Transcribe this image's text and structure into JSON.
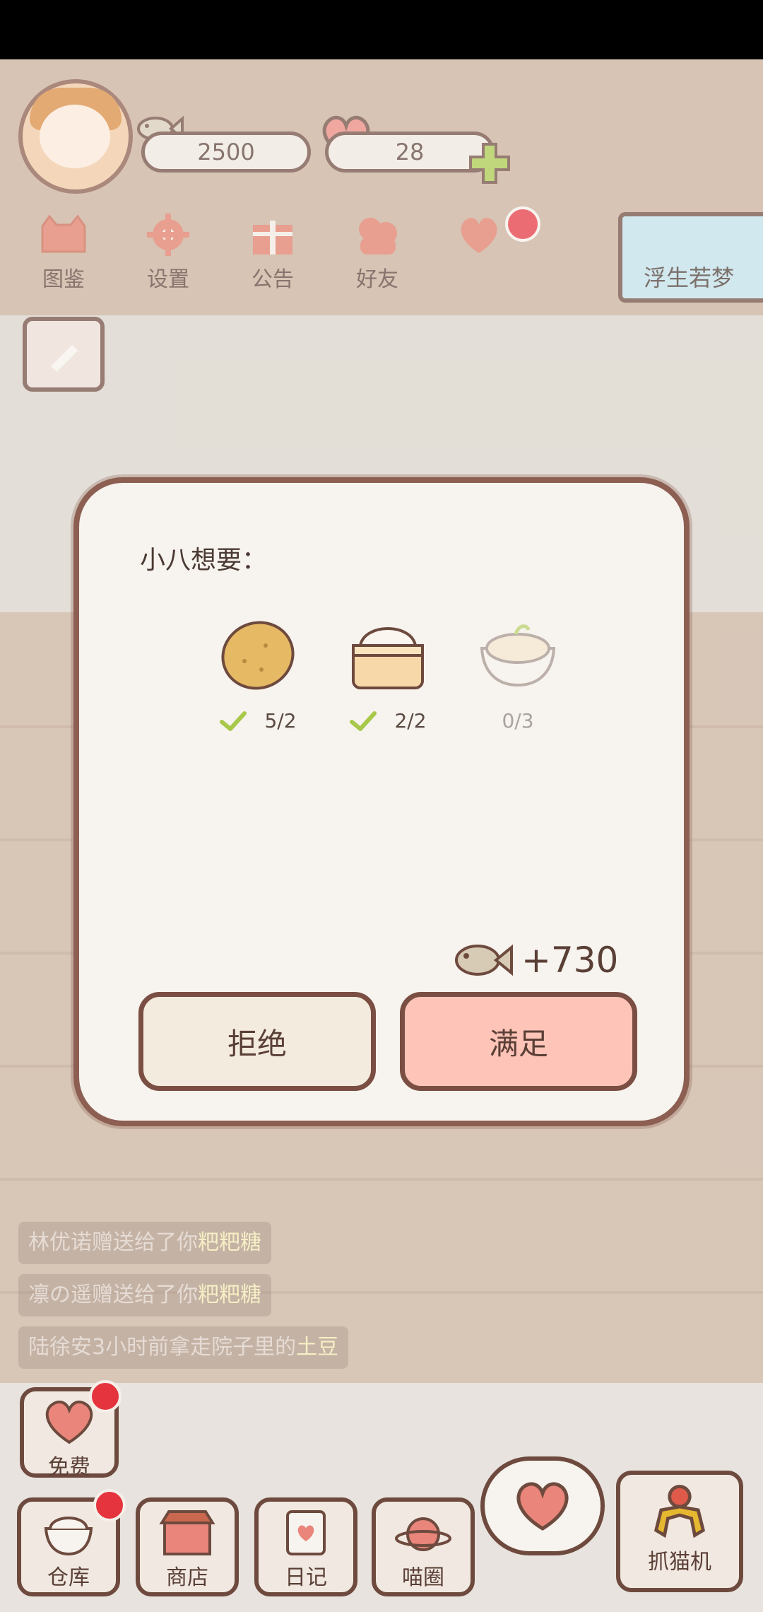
{
  "header": {
    "fish_count": "2500",
    "heart_count": "28"
  },
  "menu": [
    {
      "label": "图鉴",
      "icon": "cat-book-icon"
    },
    {
      "label": "设置",
      "icon": "gear-icon"
    },
    {
      "label": "公告",
      "icon": "gift-icon"
    },
    {
      "label": "好友",
      "icon": "friends-icon"
    },
    {
      "label": "",
      "icon": "heart-mail-icon"
    }
  ],
  "banner": {
    "label": "浮生若梦"
  },
  "chat": [
    {
      "prefix": "林优诺赠送给了你",
      "item": "粑粑糖"
    },
    {
      "prefix": "凛の遥赠送给了你",
      "item": "粑粑糖"
    },
    {
      "prefix": "陆徐安3小时前拿走院子里的",
      "item": "土豆"
    }
  ],
  "bottom": {
    "free": "免费",
    "warehouse": "仓库",
    "shop": "商店",
    "diary": "日记",
    "meow_circle": "喵圈",
    "claw_machine": "抓猫机"
  },
  "dialog": {
    "title": "小八想要：",
    "items": [
      {
        "name": "potato-icon",
        "count": "5/2",
        "done": true
      },
      {
        "name": "steamer-bun-icon",
        "count": "2/2",
        "done": true
      },
      {
        "name": "soup-bowl-icon",
        "count": "0/3",
        "done": false
      }
    ],
    "reward": "+730",
    "reject_label": "拒绝",
    "accept_label": "满足"
  },
  "colors": {
    "accent": "#ffc4b8",
    "border": "#7b4e43",
    "check": "#a8c84a",
    "notification": "#e5343e"
  }
}
